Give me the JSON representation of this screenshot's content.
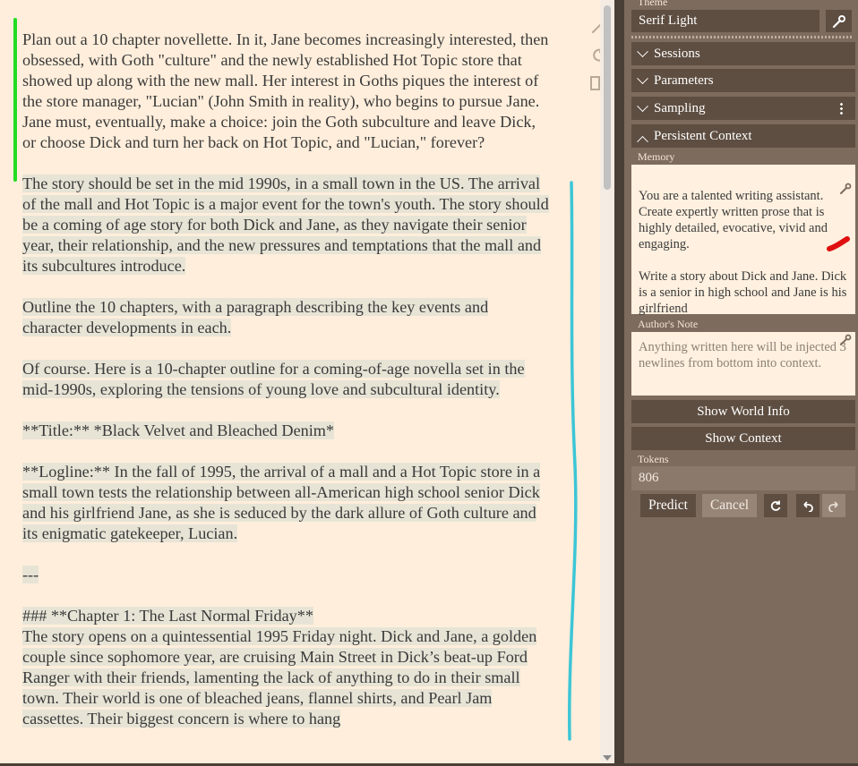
{
  "editor": {
    "prompt": "Plan out a 10 chapter novellette. In it, Jane becomes increasingly interested, then obsessed, with Goth \"culture\" and the newly established Hot Topic store that showed up along with the new mall. Her interest in Goths piques the interest of the store manager, \"Lucian\" (John Smith in reality), who begins to pursue Jane. Jane must, eventually, make a choice: join the Goth subculture and leave Dick, or choose Dick and turn her back on Hot Topic, and \"Lucian,\" forever?",
    "paragraphs": [
      "The story should be set in the mid 1990s, in a small town in the US. The arrival of the mall and Hot Topic is a major event for the town's youth. The story should be a coming of age story for both Dick and Jane, as they navigate their senior year, their relationship, and the new pressures and temptations that the mall and its subcultures introduce.",
      "Outline the 10 chapters, with a paragraph describing the key events and character developments in each.",
      "Of course. Here is a 10-chapter outline for a coming-of-age novella set in the mid-1990s, exploring the tensions of young love and subcultural identity.",
      "**Title:** *Black Velvet and Bleached Denim*",
      "**Logline:** In the fall of 1995, the arrival of a mall and a Hot Topic store in a small town tests the relationship between all-American high school senior Dick and his girlfriend Jane, as she is seduced by the dark allure of Goth culture and its enigmatic gatekeeper, Lucian.",
      "---",
      "### **Chapter 1: The Last Normal Friday**\nThe story opens on a quintessential 1995 Friday night. Dick and Jane, a golden couple since sophomore year, are cruising Main Street in Dick’s beat-up Ford Ranger with their friends, lamenting the lack of anything to do in their small town. Their world is one of bleached jeans, flannel shirts, and Pearl Jam cassettes. Their biggest concern is where to hang"
    ]
  },
  "panel": {
    "theme_label": "Theme",
    "theme_value": "Serif Light",
    "sections": [
      "Sessions",
      "Parameters",
      "Sampling",
      "Persistent Context"
    ],
    "memory_label": "Memory",
    "memory_text": "You are a talented writing assistant. Create expertly written prose that is highly detailed, evocative, vivid and engaging.\n\nWrite a story about Dick and Jane. Dick is a senior in high school and Jane is his girlfriend",
    "authors_note_label": "Author's Note",
    "authors_note_placeholder": "Anything written here will be injected 3 newlines from bottom into context.",
    "show_world_info": "Show World Info",
    "show_context": "Show Context",
    "tokens_label": "Tokens",
    "tokens_value": "806",
    "predict": "Predict",
    "cancel": "Cancel"
  },
  "colors": {
    "editor_bg": "#ffeedb",
    "panel_bg": "#7d6b5d",
    "button_bg": "#5e4e41",
    "highlight": "#e7e4d6",
    "green_marker": "#22dd22",
    "cyan_marker": "#3cc6d6",
    "red_marker": "#e01010"
  }
}
